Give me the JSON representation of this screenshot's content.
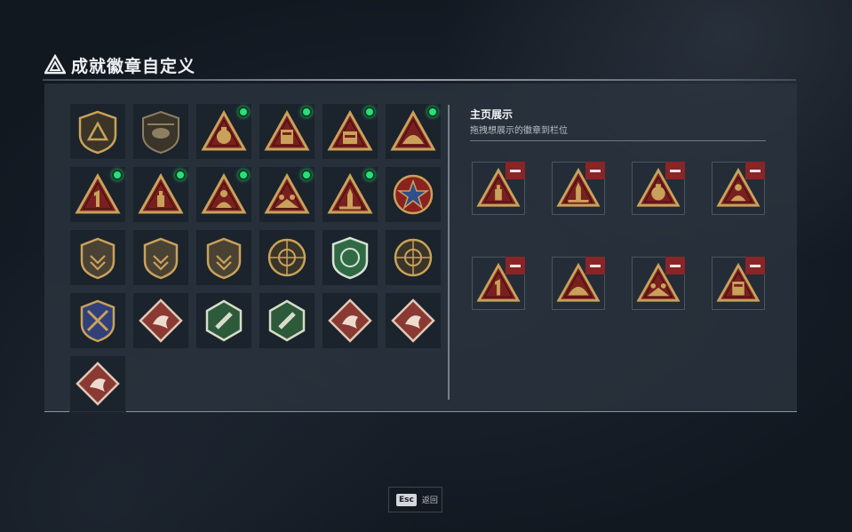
{
  "header": {
    "title": "成就徽章自定义",
    "logo_icon": "triangle-logo-icon"
  },
  "badges": [
    {
      "icon": "shield-triangle-badge",
      "new": false
    },
    {
      "icon": "helicopter-badge",
      "new": false
    },
    {
      "icon": "money-bag-triangle-badge",
      "new": true
    },
    {
      "icon": "gold-bars-triangle-badge",
      "new": true
    },
    {
      "icon": "sr-crate-triangle-badge",
      "new": true
    },
    {
      "icon": "dome-triangle-badge",
      "new": true
    },
    {
      "icon": "number-one-triangle-badge",
      "new": true
    },
    {
      "icon": "bottle-triangle-badge",
      "new": true
    },
    {
      "icon": "soldier-triangle-badge",
      "new": true
    },
    {
      "icon": "squad-triangle-badge",
      "new": true
    },
    {
      "icon": "rocket-triangle-badge",
      "new": true
    },
    {
      "icon": "star-emblem-badge",
      "new": false
    },
    {
      "icon": "chevron-shield-badge",
      "new": false
    },
    {
      "icon": "starred-shield-badge",
      "new": false
    },
    {
      "icon": "gem-shield-badge",
      "new": false
    },
    {
      "icon": "crosshair-operator-badge",
      "new": false
    },
    {
      "icon": "green-sniper-badge",
      "new": false
    },
    {
      "icon": "no-pistol-badge",
      "new": false
    },
    {
      "icon": "laurel-swords-badge",
      "new": false
    },
    {
      "icon": "red-beast-diamond-badge",
      "new": false
    },
    {
      "icon": "green-wasp-hexagon-badge",
      "new": false
    },
    {
      "icon": "green-rocket-hexagon-badge",
      "new": false
    },
    {
      "icon": "red-dragon-diamond-badge",
      "new": false
    },
    {
      "icon": "red-wolf-diamond-badge",
      "new": false
    },
    {
      "icon": "red-runner-diamond-badge",
      "new": false
    }
  ],
  "showcase": {
    "title": "主页展示",
    "subtitle": "拖拽想展示的徽章到栏位",
    "slots": [
      {
        "icon": "bottle-triangle-badge"
      },
      {
        "icon": "rocket-triangle-badge"
      },
      {
        "icon": "money-bag-triangle-badge"
      },
      {
        "icon": "soldier-triangle-badge"
      },
      {
        "icon": "number-one-triangle-badge"
      },
      {
        "icon": "dome-triangle-badge"
      },
      {
        "icon": "squad-triangle-badge"
      },
      {
        "icon": "gold-bars-triangle-badge"
      }
    ],
    "remove_icon": "minus-icon"
  },
  "footer": {
    "esc_key": "Esc",
    "back_label": "返回"
  },
  "colors": {
    "accent_green": "#27e07a",
    "remove_red": "#8b2427",
    "badge_gold": "#c9a25a",
    "badge_red": "#7a1f1f",
    "panel": "#2c343f"
  }
}
